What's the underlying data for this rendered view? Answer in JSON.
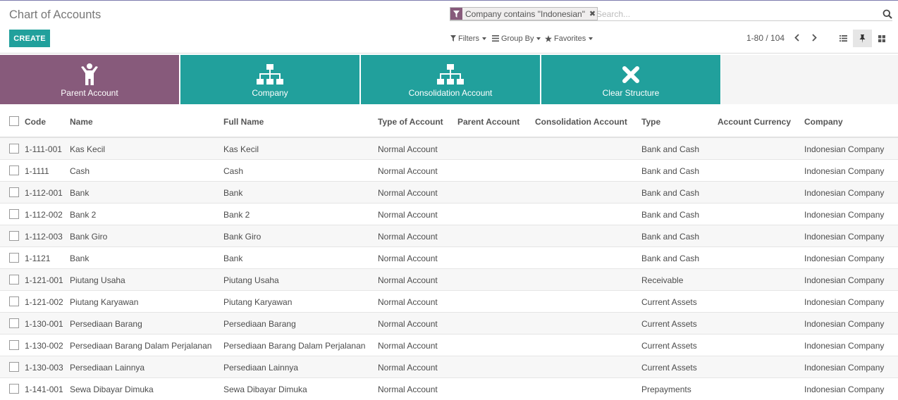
{
  "title": "Chart of Accounts",
  "create_label": "CREATE",
  "search": {
    "facet_value": "Company contains \"Indonesian\"",
    "placeholder": "Search..."
  },
  "filters_label": "Filters",
  "groupby_label": "Group By",
  "favorites_label": "Favorites",
  "pager": "1-80 / 104",
  "structure_buttons": [
    {
      "label": "Parent Account",
      "color": "#875a7b",
      "icon": "person-icon"
    },
    {
      "label": "Company",
      "color": "#21a09c",
      "icon": "hierarchy-icon"
    },
    {
      "label": "Consolidation Account",
      "color": "#21a09c",
      "icon": "hierarchy-icon"
    },
    {
      "label": "Clear Structure",
      "color": "#21a09c",
      "icon": "close-x-icon"
    }
  ],
  "columns": [
    "Code",
    "Name",
    "Full Name",
    "Type of Account",
    "Parent Account",
    "Consolidation Account",
    "Type",
    "Account Currency",
    "Company"
  ],
  "rows": [
    {
      "code": "1-111-001",
      "name": "Kas Kecil",
      "full_name": "Kas Kecil",
      "account_type": "Normal Account",
      "parent": "",
      "consolidation": "",
      "type": "Bank and Cash",
      "currency": "",
      "company": "Indonesian Company"
    },
    {
      "code": "1-1111",
      "name": "Cash",
      "full_name": "Cash",
      "account_type": "Normal Account",
      "parent": "",
      "consolidation": "",
      "type": "Bank and Cash",
      "currency": "",
      "company": "Indonesian Company"
    },
    {
      "code": "1-112-001",
      "name": "Bank",
      "full_name": "Bank",
      "account_type": "Normal Account",
      "parent": "",
      "consolidation": "",
      "type": "Bank and Cash",
      "currency": "",
      "company": "Indonesian Company"
    },
    {
      "code": "1-112-002",
      "name": "Bank 2",
      "full_name": "Bank 2",
      "account_type": "Normal Account",
      "parent": "",
      "consolidation": "",
      "type": "Bank and Cash",
      "currency": "",
      "company": "Indonesian Company"
    },
    {
      "code": "1-112-003",
      "name": "Bank Giro",
      "full_name": "Bank Giro",
      "account_type": "Normal Account",
      "parent": "",
      "consolidation": "",
      "type": "Bank and Cash",
      "currency": "",
      "company": "Indonesian Company"
    },
    {
      "code": "1-1121",
      "name": "Bank",
      "full_name": "Bank",
      "account_type": "Normal Account",
      "parent": "",
      "consolidation": "",
      "type": "Bank and Cash",
      "currency": "",
      "company": "Indonesian Company"
    },
    {
      "code": "1-121-001",
      "name": "Piutang Usaha",
      "full_name": "Piutang Usaha",
      "account_type": "Normal Account",
      "parent": "",
      "consolidation": "",
      "type": "Receivable",
      "currency": "",
      "company": "Indonesian Company"
    },
    {
      "code": "1-121-002",
      "name": "Piutang Karyawan",
      "full_name": "Piutang Karyawan",
      "account_type": "Normal Account",
      "parent": "",
      "consolidation": "",
      "type": "Current Assets",
      "currency": "",
      "company": "Indonesian Company"
    },
    {
      "code": "1-130-001",
      "name": "Persediaan Barang",
      "full_name": "Persediaan Barang",
      "account_type": "Normal Account",
      "parent": "",
      "consolidation": "",
      "type": "Current Assets",
      "currency": "",
      "company": "Indonesian Company"
    },
    {
      "code": "1-130-002",
      "name": "Persediaan Barang Dalam Perjalanan",
      "full_name": "Persediaan Barang Dalam Perjalanan",
      "account_type": "Normal Account",
      "parent": "",
      "consolidation": "",
      "type": "Current Assets",
      "currency": "",
      "company": "Indonesian Company"
    },
    {
      "code": "1-130-003",
      "name": "Persediaan Lainnya",
      "full_name": "Persediaan Lainnya",
      "account_type": "Normal Account",
      "parent": "",
      "consolidation": "",
      "type": "Current Assets",
      "currency": "",
      "company": "Indonesian Company"
    },
    {
      "code": "1-141-001",
      "name": "Sewa Dibayar Dimuka",
      "full_name": "Sewa Dibayar Dimuka",
      "account_type": "Normal Account",
      "parent": "",
      "consolidation": "",
      "type": "Prepayments",
      "currency": "",
      "company": "Indonesian Company"
    }
  ]
}
